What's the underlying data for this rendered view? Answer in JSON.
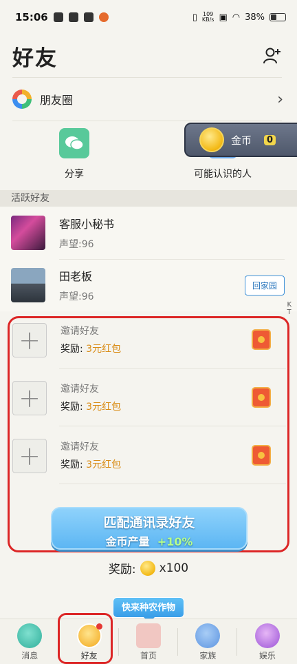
{
  "status": {
    "time": "15:06",
    "net_speed_top": "109",
    "net_speed_unit": "KB/s",
    "battery": "38%"
  },
  "header": {
    "title": "好友"
  },
  "moments": {
    "label": "朋友圈"
  },
  "quick": {
    "share": "分享",
    "people": "可能认识的人"
  },
  "coin_pill": {
    "label": "金币",
    "value": "0"
  },
  "section": {
    "active_friends": "活跃好友"
  },
  "friends": [
    {
      "name": "客服小秘书",
      "rep": "声望:96"
    },
    {
      "name": "田老板",
      "rep": "声望:96",
      "action": "回家园"
    }
  ],
  "side_mark": "K\nT",
  "invites": [
    {
      "title": "邀请好友",
      "reward_label": "奖励: ",
      "reward_value": "3元红包"
    },
    {
      "title": "邀请好友",
      "reward_label": "奖励: ",
      "reward_value": "3元红包"
    },
    {
      "title": "邀请好友",
      "reward_label": "奖励: ",
      "reward_value": "3元红包"
    }
  ],
  "match": {
    "line1": "匹配通讯录好友",
    "line2_prefix": "金币产量",
    "line2_bonus": "+10%"
  },
  "reward": {
    "label": "奖励:",
    "amount": "x100"
  },
  "tip": "快来种农作物",
  "tabs": [
    {
      "label": "消息",
      "icon": "message-icon"
    },
    {
      "label": "好友",
      "icon": "friends-icon"
    },
    {
      "label": "首页",
      "icon": "home-icon"
    },
    {
      "label": "家族",
      "icon": "family-icon"
    },
    {
      "label": "娱乐",
      "icon": "planet-icon"
    }
  ]
}
